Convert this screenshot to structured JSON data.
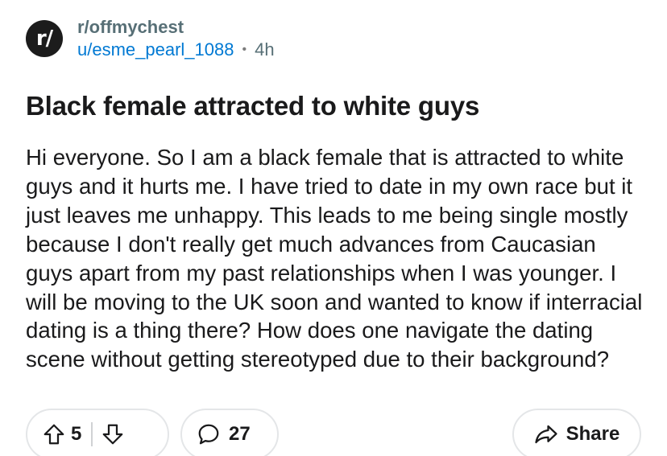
{
  "post": {
    "subreddit_icon": "r/",
    "subreddit": "r/offmychest",
    "author": "u/esme_pearl_1088",
    "separator": "•",
    "age": "4h",
    "title": "Black female attracted to white guys",
    "body": "Hi everyone. So I am a black female that is attracted to white guys and it hurts me. I have tried to date in my own race but it just leaves me unhappy. This leads to me being single mostly because I don't really get much advances from Caucasian guys apart from my past relationships when I was younger. I will be moving to the UK soon and wanted to know if interracial dating is a thing there? How does one navigate the dating scene without getting stereotyped due to their background?"
  },
  "actions": {
    "upvotes": "5",
    "comments": "27",
    "share_label": "Share"
  },
  "icons": [
    "upvote-arrow-icon",
    "downvote-arrow-icon",
    "comment-bubble-icon",
    "share-arrow-icon"
  ],
  "colors": {
    "subreddit": "#576f76",
    "username": "#0079d3",
    "text": "#1a1a1b",
    "pill_border": "#e4e6e8"
  }
}
